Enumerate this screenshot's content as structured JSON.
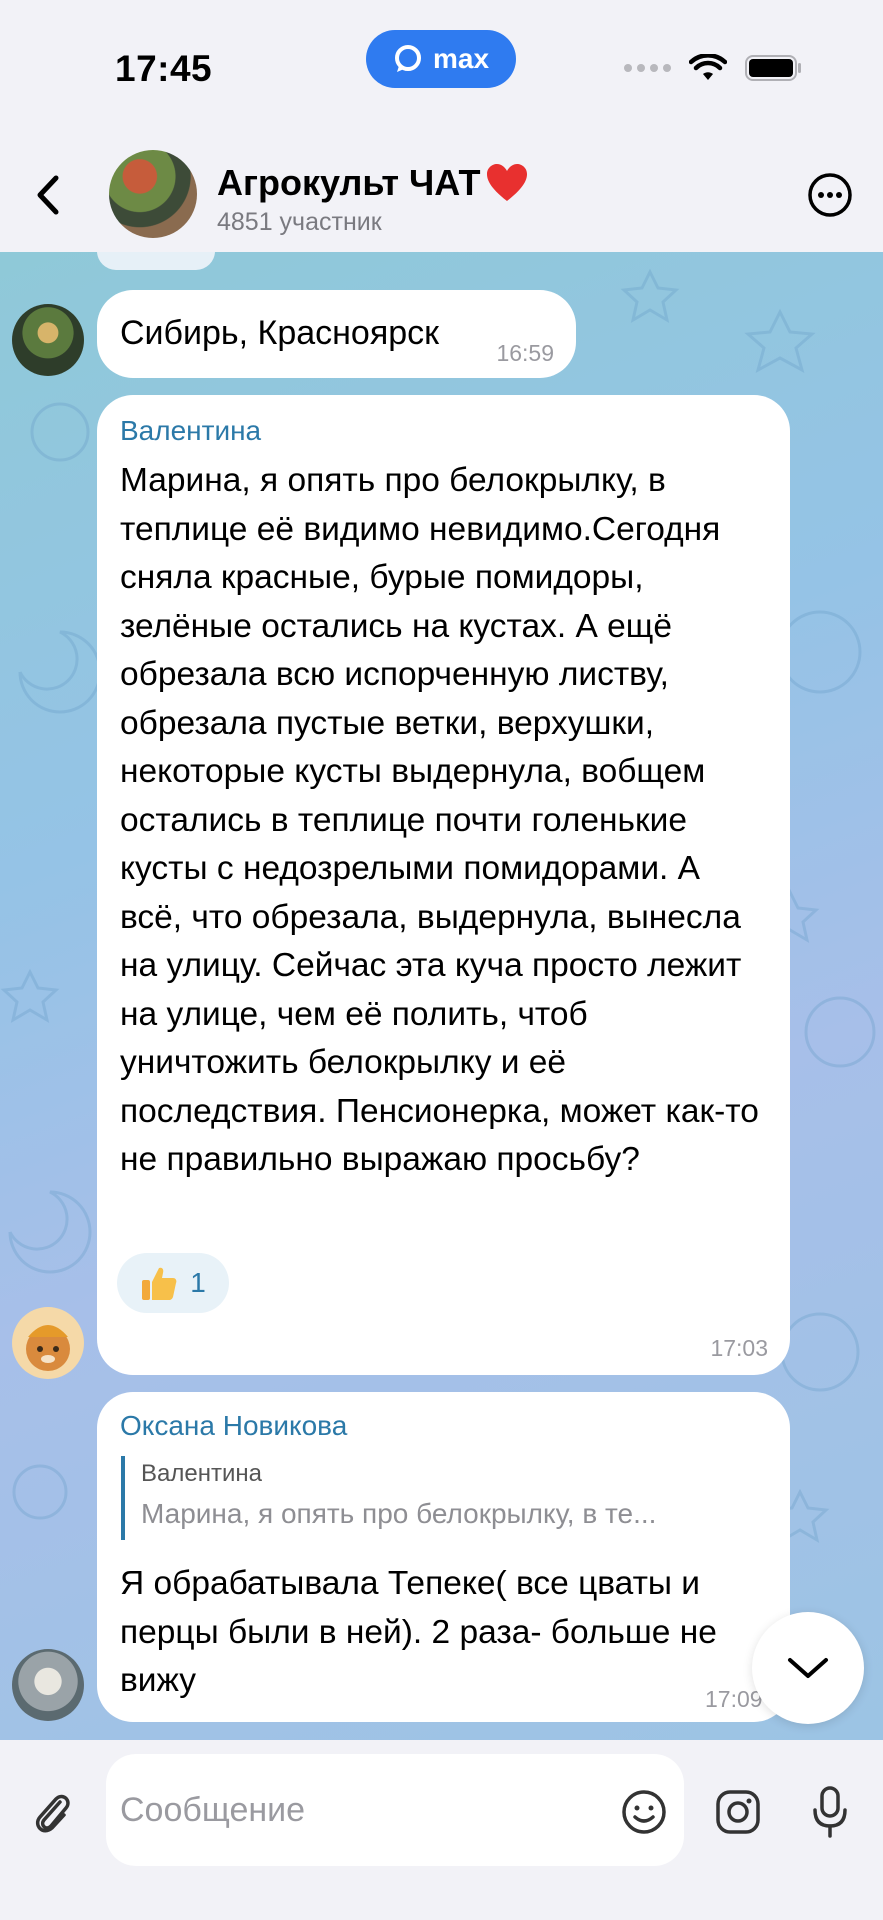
{
  "status_bar": {
    "time": "17:45",
    "brand": "max"
  },
  "header": {
    "title": "Агрокульт ЧАТ",
    "subtitle": "4851 участник"
  },
  "messages": [
    {
      "text": "Сибирь, Красноярск",
      "time": "16:59"
    },
    {
      "sender": "Валентина",
      "text": "Марина,  я опять про белокрылку, в теплице  её  видимо невидимо.Сегодня сняла красные, бурые помидоры, зелёные остались на кустах.  А ещё обрезала всю испорченную листву, обрезала пустые ветки, верхушки, некоторые кусты выдернула, вобщем остались в теплице  почти голенькие кусты с недозрелыми помидорами. А всё, что обрезала, выдернула, вынесла на улицу. Сейчас эта куча просто лежит на улице,  чем её  полить, чтоб уничтожить белокрылку и её последствия. Пенсионерка, может как-то  не правильно выражаю просьбу?",
      "reaction_count": "1",
      "time": "17:03"
    },
    {
      "sender": "Оксана Новикова",
      "reply_to": {
        "name": "Валентина",
        "text": "Марина,  я опять про белокрылку, в те..."
      },
      "text": "Я обрабатывала Тепеке( все цваты и перцы были в ней). 2 раза- больше не вижу",
      "time": "17:09"
    }
  ],
  "composer": {
    "placeholder": "Сообщение"
  },
  "colors": {
    "accent": "#2b79a8",
    "brand": "#2f7bf0",
    "background_gradient": [
      "#8fc9d8",
      "#a7bfe9"
    ]
  },
  "icons": [
    "back-arrow-icon",
    "more-icon",
    "heart-icon",
    "thumbs-up-icon",
    "chevron-down-icon",
    "paperclip-icon",
    "emoji-icon",
    "camera-icon",
    "microphone-icon",
    "wifi-icon",
    "battery-icon"
  ]
}
